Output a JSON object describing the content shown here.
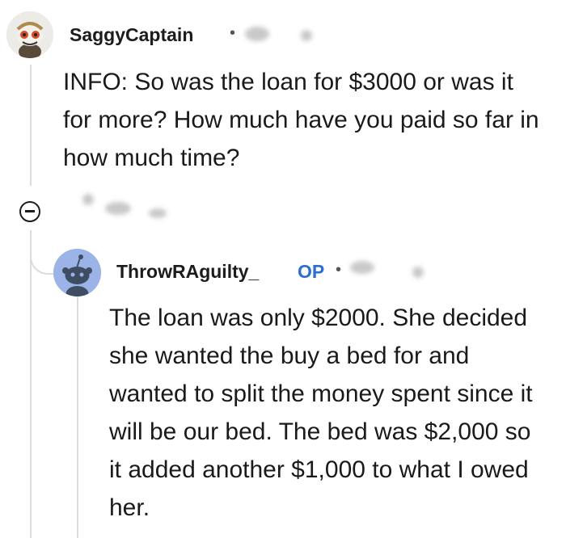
{
  "comment1": {
    "username": "SaggyCaptain",
    "separator": "•",
    "body": "INFO: So was the loan for $3000 or was it for more? How much have you paid so far in how much time?"
  },
  "reply": {
    "username": "ThrowRAguilty_",
    "badge": "OP",
    "separator": "•",
    "body": "The loan was only $2000. She decided she wanted the buy a bed for and wanted to split the money spent since it will be our bed. The bed was $2,000 so it added another $1,000 to what I owed her."
  },
  "colors": {
    "op_badge": "#2a6fd6",
    "thread_line": "#dcdcdc"
  },
  "icons": {
    "collapse": "minus-circle-icon"
  }
}
